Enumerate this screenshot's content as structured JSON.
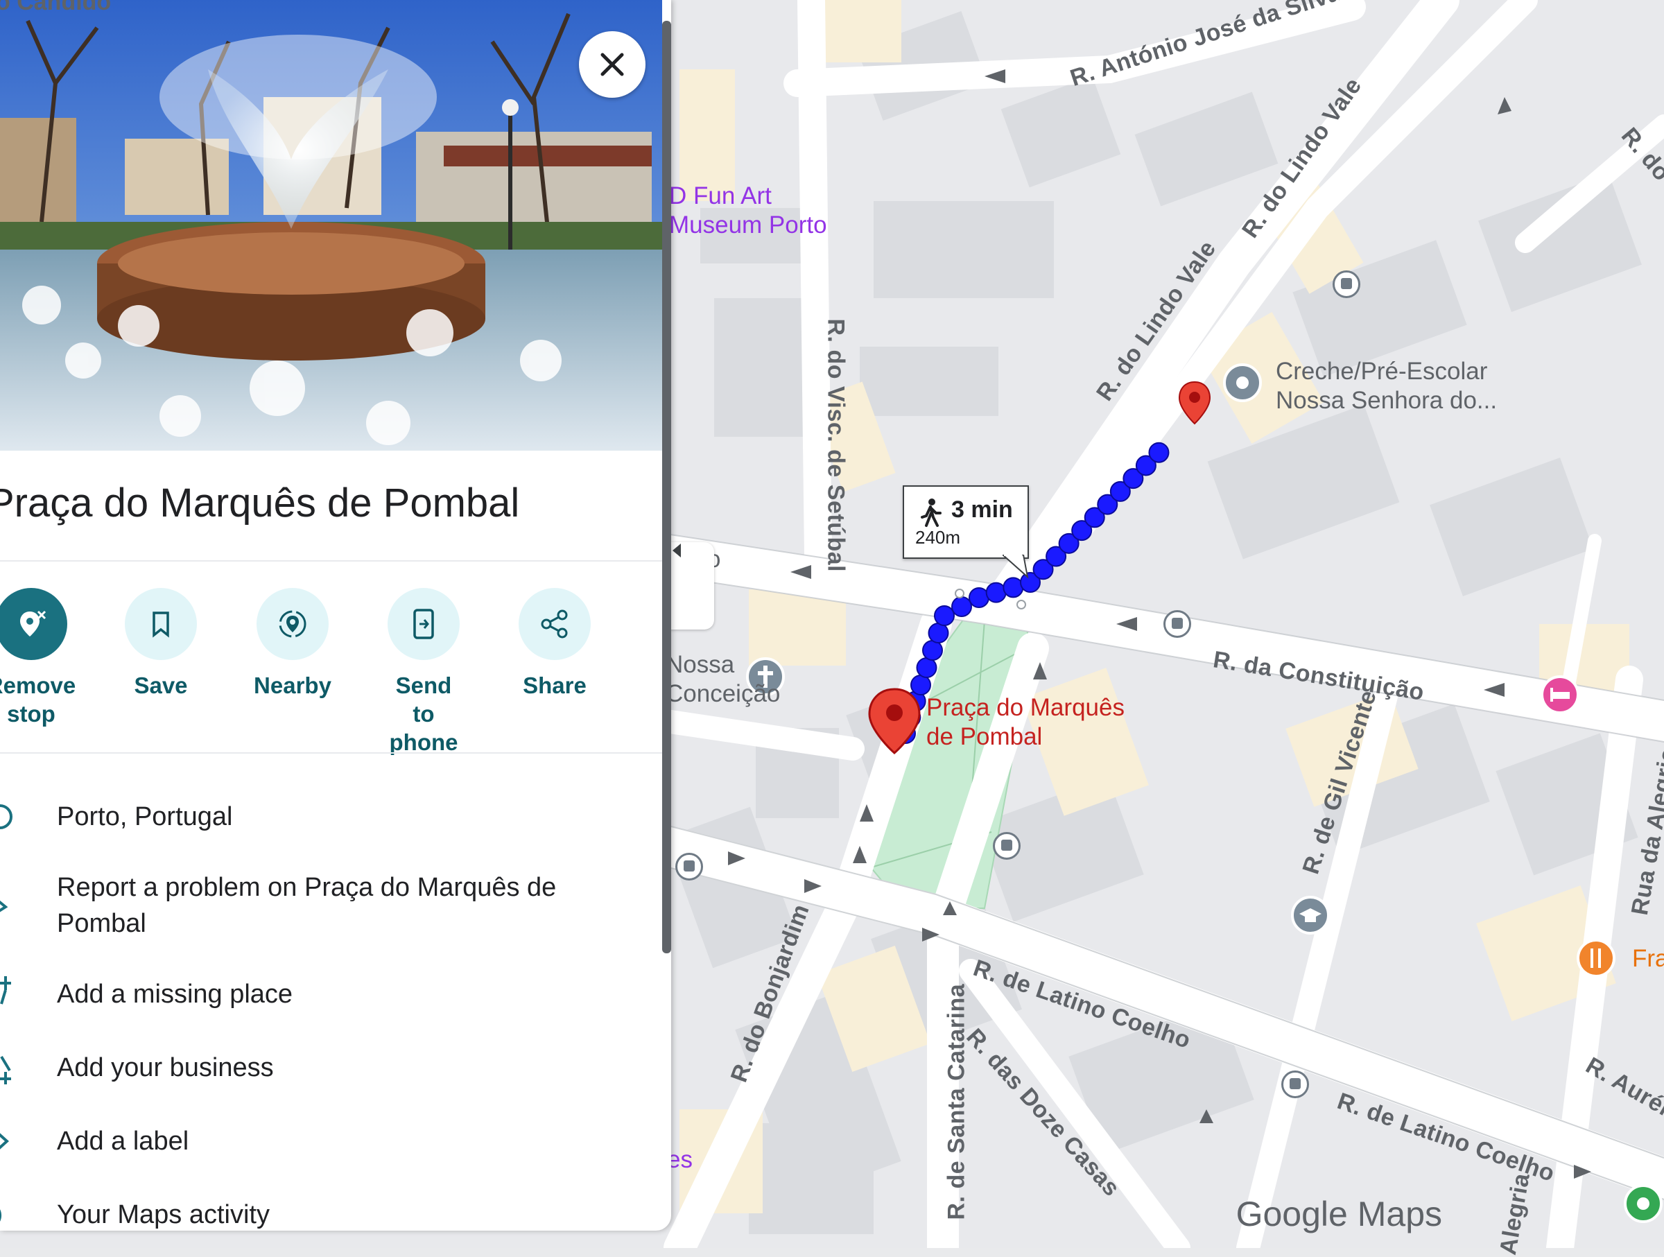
{
  "panel": {
    "title": "Praça do Marquês de Pombal",
    "close_icon": "close-icon",
    "actions": [
      {
        "label": "Remove stop",
        "icon": "remove-pin-icon"
      },
      {
        "label": "Save",
        "icon": "bookmark-icon"
      },
      {
        "label": "Nearby",
        "icon": "nearby-icon"
      },
      {
        "label": "Send to phone",
        "icon": "send-to-phone-icon"
      },
      {
        "label": "Share",
        "icon": "share-icon"
      }
    ],
    "info": [
      {
        "text": "Porto, Portugal",
        "icon": "location-pin-icon"
      },
      {
        "text": "Report a problem on Praça do Marquês de Pombal",
        "icon": "edit-icon"
      },
      {
        "text": "Add a missing place",
        "icon": "add-place-icon"
      },
      {
        "text": "Add your business",
        "icon": "add-business-icon"
      },
      {
        "text": "Add a label",
        "icon": "label-icon"
      },
      {
        "text": "Your Maps activity",
        "icon": "history-icon"
      }
    ],
    "top_fragment": "o Cândido"
  },
  "route": {
    "mode": "walking",
    "time": "3 min",
    "distance": "240m"
  },
  "map": {
    "streets": [
      "R. António José da Silva",
      "R. do Lindo Vale",
      "R. do Lindo Vale",
      "R. do Visc. de Setúbal",
      "R. da Constituição",
      "R. de Gil Vicente",
      "Rua da Alegria",
      "R. de Latino Coelho",
      "R. de Latino Coelho",
      "R. das Doze Casas",
      "R. de Santa Catarina",
      "R. do Bonjardim",
      "R. Aurélia",
      "R. do",
      "Alegria"
    ],
    "pois": {
      "museum": "D Fun Art Museum Porto",
      "creche": "Creche/Pré-Escolar Nossa Senhora do...",
      "destination": "Praça do Marquês de Pombal",
      "church": "Nossa Conceição",
      "restaurant": "Fra",
      "fragment_es": "es",
      "fragment_o": "o"
    },
    "logo": "Google Maps",
    "colors": {
      "route_dot": "#1a1aff",
      "pin": "#d93025",
      "park": "#c8ecd3"
    }
  }
}
